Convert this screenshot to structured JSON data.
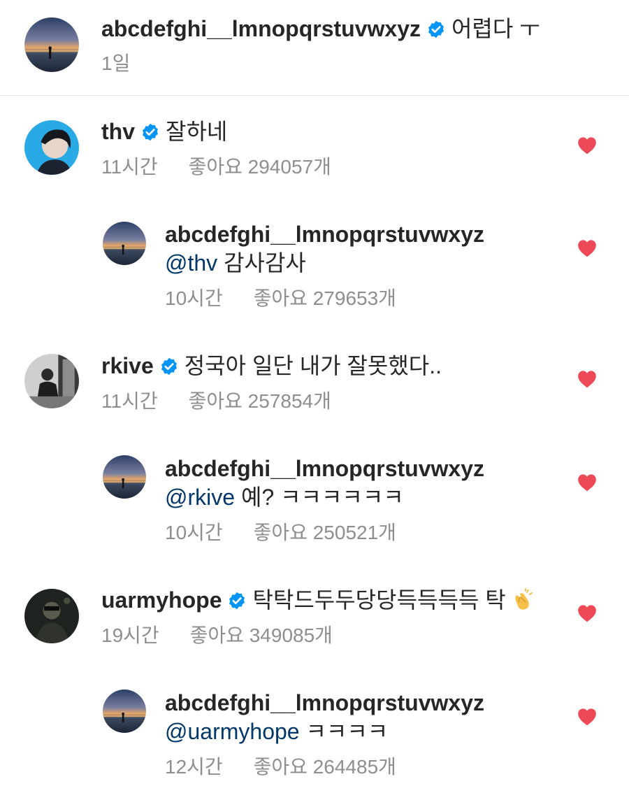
{
  "caption": {
    "username": "abcdefghi__lmnopqrstuvwxyz",
    "text": "어렵다 ㅜ",
    "time": "1일"
  },
  "comments": [
    {
      "username": "thv",
      "text": "잘하네",
      "time": "11시간",
      "likes": "좋아요 294057개",
      "reply": {
        "username": "abcdefghi__lmnopqrstuvwxyz",
        "mention": "@thv",
        "text": " 감사감사",
        "time": "10시간",
        "likes": "좋아요 279653개"
      }
    },
    {
      "username": "rkive",
      "text": "정국아 일단 내가 잘못했다..",
      "time": "11시간",
      "likes": "좋아요 257854개",
      "reply": {
        "username": "abcdefghi__lmnopqrstuvwxyz",
        "mention": "@rkive",
        "text": " 예? ㅋㅋㅋㅋㅋㅋ",
        "time": "10시간",
        "likes": "좋아요 250521개"
      }
    },
    {
      "username": "uarmyhope",
      "text": "탁탁드두두당당득득득득 탁",
      "emoji": "clapping-hands-emoji",
      "time": "19시간",
      "likes": "좋아요 349085개",
      "reply": {
        "username": "abcdefghi__lmnopqrstuvwxyz",
        "mention": "@uarmyhope",
        "text": " ㅋㅋㅋㅋ",
        "time": "12시간",
        "likes": "좋아요 264485개"
      }
    }
  ],
  "colors": {
    "verified": "#0095f6",
    "heart": "#ed4956",
    "mention": "#00376b",
    "meta": "#8e8e8e"
  },
  "icons": [
    "verified-badge-icon",
    "heart-icon",
    "clapping-hands-emoji"
  ]
}
